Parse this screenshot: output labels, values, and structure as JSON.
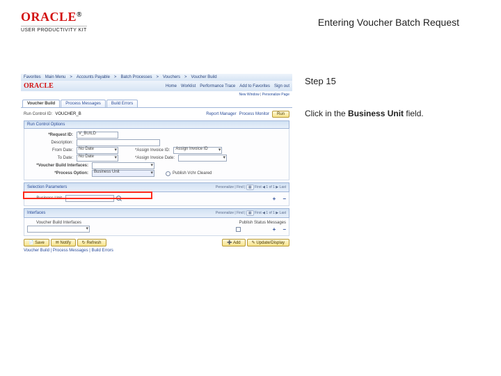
{
  "header": {
    "brand_name": "ORACLE",
    "brand_flag": "®",
    "brand_sub": "USER PRODUCTIVITY KIT",
    "page_title": "Entering Voucher Batch Request"
  },
  "step": {
    "label": "Step 15"
  },
  "instruction": {
    "pre": "Click in the ",
    "bold": "Business Unit",
    "post": " field."
  },
  "app": {
    "nav": {
      "items": [
        "Favorites",
        "Main Menu",
        "Accounts Payable",
        "Batch Processes",
        "Vouchers",
        "Voucher Build"
      ]
    },
    "brand_word": "ORACLE",
    "topmenu": [
      "Home",
      "Worklist",
      "Performance Trace",
      "Add to Favorites",
      "Sign out"
    ],
    "userline": {
      "newwin": "New Window",
      "pers": "Personalize Page"
    },
    "tabs": [
      {
        "label": "Voucher Build",
        "active": true
      },
      {
        "label": "Process Messages",
        "active": false
      },
      {
        "label": "Build Errors",
        "active": false
      }
    ],
    "runcontrol": {
      "label": "Run Control ID:",
      "value": "VOUCHER_B",
      "rm_label": "Report Manager",
      "pm_label": "Process Monitor",
      "run_btn": "Run"
    },
    "sections": {
      "rco": {
        "title": "Run Control Options",
        "request_id_lbl": "*Request ID:",
        "request_id_val": "V_BUILD",
        "description_lbl": "Description:",
        "from_date_lbl": "From Date:",
        "to_date_lbl": "To Date:",
        "assign_inv_lbl": "*Assign Invoice ID:",
        "assign_inv_val": "Assign Invoice ID",
        "date_opt_val": "No Date",
        "assign_date_lbl": "*Assign Invoice Date:",
        "vb_interfaces_lbl": "*Voucher Build Interfaces:",
        "vb_interfaces_val": "",
        "process_option_lbl": "*Process Option:",
        "process_option_val": "Business Unit",
        "publish_cleared": "Publish Vchr Cleared"
      },
      "sel": {
        "title": "Selection Parameters",
        "bar": {
          "pers": "Personalize",
          "find": "Find",
          "count": "1 of 1",
          "first": "First",
          "last": "Last"
        },
        "bu_lbl": "Business Unit"
      },
      "int": {
        "title": "Interfaces",
        "bar": {
          "pers": "Personalize",
          "find": "Find",
          "count": "1 of 1",
          "first": "First",
          "last": "Last"
        }
      },
      "vbi": {
        "title": "Voucher Build Interfaces",
        "publish_msg": "Publish Status Messages"
      }
    },
    "footer": {
      "save": "Save",
      "notify": "Notify",
      "refresh": "Refresh",
      "add": "Add",
      "update": "Update/Display",
      "crumbs": "Voucher Build | Process Messages | Build Errors"
    }
  }
}
